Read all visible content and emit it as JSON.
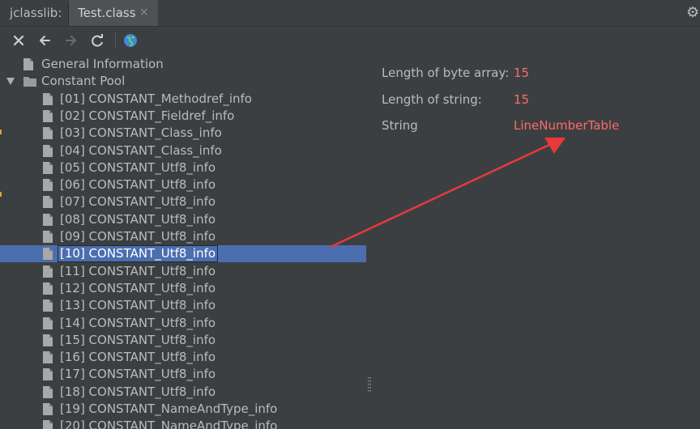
{
  "tabbar": {
    "title": "jclasslib:",
    "tab_label": "Test.class",
    "tab_close": "×",
    "gear": "⚙"
  },
  "toolbar": {
    "icons": [
      "close-icon",
      "back-arrow-icon",
      "forward-arrow-icon",
      "refresh-icon",
      "web-globe-icon"
    ]
  },
  "tree": {
    "items": [
      {
        "label": "General Information"
      },
      {
        "label": "Constant Pool"
      },
      {
        "label": "[01] CONSTANT_Methodref_info"
      },
      {
        "label": "[02] CONSTANT_Fieldref_info"
      },
      {
        "label": "[03] CONSTANT_Class_info"
      },
      {
        "label": "[04] CONSTANT_Class_info"
      },
      {
        "label": "[05] CONSTANT_Utf8_info"
      },
      {
        "label": "[06] CONSTANT_Utf8_info"
      },
      {
        "label": "[07] CONSTANT_Utf8_info"
      },
      {
        "label": "[08] CONSTANT_Utf8_info"
      },
      {
        "label": "[09] CONSTANT_Utf8_info"
      },
      {
        "label": "[10] CONSTANT_Utf8_info"
      },
      {
        "label": "[11] CONSTANT_Utf8_info"
      },
      {
        "label": "[12] CONSTANT_Utf8_info"
      },
      {
        "label": "[13] CONSTANT_Utf8_info"
      },
      {
        "label": "[14] CONSTANT_Utf8_info"
      },
      {
        "label": "[15] CONSTANT_Utf8_info"
      },
      {
        "label": "[16] CONSTANT_Utf8_info"
      },
      {
        "label": "[17] CONSTANT_Utf8_info"
      },
      {
        "label": "[18] CONSTANT_Utf8_info"
      },
      {
        "label": "[19] CONSTANT_NameAndType_info"
      },
      {
        "label": "[20] CONSTANT_NameAndType_info"
      }
    ],
    "selected": "[10] CONSTANT_Utf8_info"
  },
  "detail": {
    "rows": [
      {
        "key": "Length of byte array:",
        "value": "15"
      },
      {
        "key": "Length of string:",
        "value": "15"
      },
      {
        "key": "String",
        "value": "LineNumberTable"
      }
    ]
  },
  "colors": {
    "background": "#3c3f41",
    "selection": "#4b6eaf",
    "value_red": "#ff6b68",
    "annotation_arrow": "#e8393a"
  }
}
